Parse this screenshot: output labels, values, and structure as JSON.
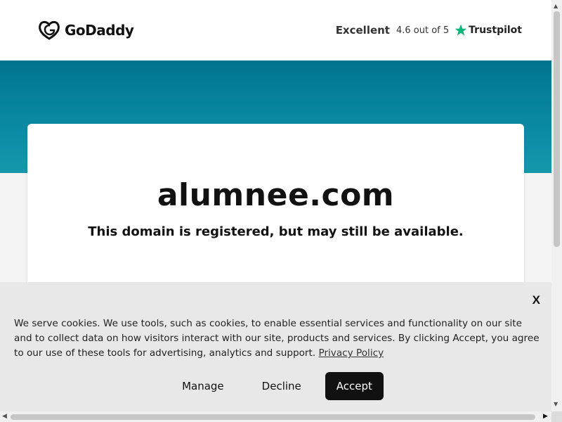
{
  "header": {
    "logo_text": "GoDaddy",
    "rating_label": "Excellent",
    "rating_score": "4.6 out of 5",
    "trustpilot_label": "Trustpilot"
  },
  "main": {
    "domain": "alumnee.com",
    "subtitle": "This domain is registered, but may still be available."
  },
  "cookie_banner": {
    "close_label": "X",
    "text": "We serve cookies. We use tools, such as cookies, to enable essential services and functionality on our site and to collect data on how visitors interact with our site, products and services. By clicking Accept, you agree to our use of these tools for advertising, analytics and support.",
    "privacy_link": "Privacy Policy",
    "manage_label": "Manage",
    "decline_label": "Decline",
    "accept_label": "Accept"
  },
  "colors": {
    "hero": "#00748f",
    "trustpilot_star": "#00b67a",
    "accept_bg": "#111111"
  }
}
